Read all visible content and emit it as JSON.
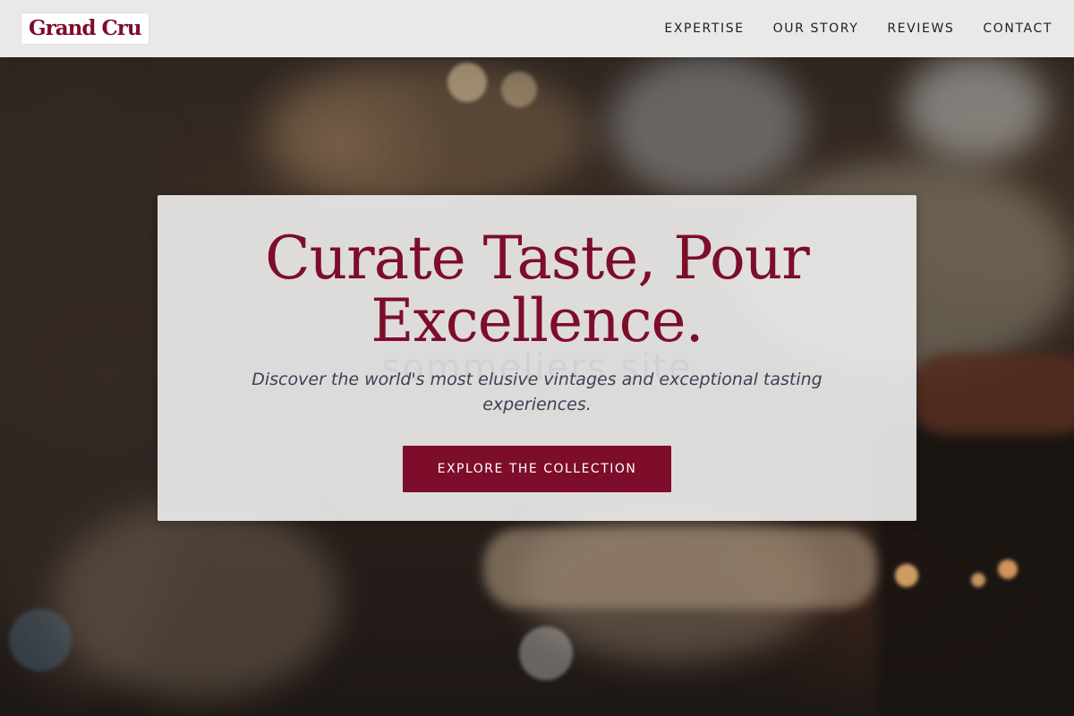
{
  "header": {
    "logo_text": "Grand Cru",
    "nav": [
      {
        "label": "EXPERTISE"
      },
      {
        "label": "OUR STORY"
      },
      {
        "label": "REVIEWS"
      },
      {
        "label": "CONTACT"
      }
    ]
  },
  "hero": {
    "title_line1": "Curate Taste, Pour",
    "title_line2": "Excellence.",
    "subtitle": "Discover the world's most elusive vintages and exceptional tasting experiences.",
    "cta_label": "EXPLORE THE COLLECTION",
    "watermark_text": "sommeliers.site"
  },
  "colors": {
    "brand": "#7d0d2a",
    "header_bg": "#f0f0f0",
    "subtitle_text": "#3b4352"
  }
}
